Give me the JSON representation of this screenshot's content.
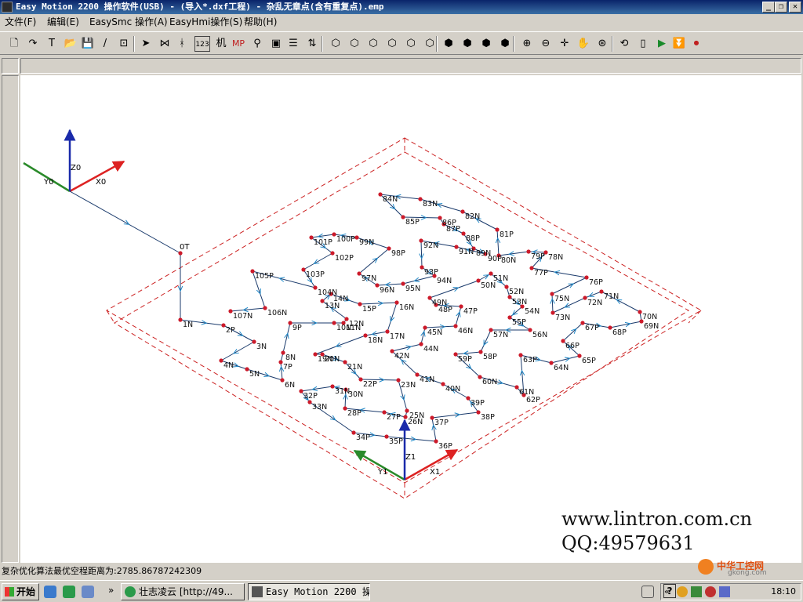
{
  "window": {
    "title": "Easy Motion 2200 操作软件(USB) - (导入*.dxf工程) - 杂乱无章点(含有重复点).emp",
    "min_glyph": "_",
    "max_glyph": "❐",
    "close_glyph": "✕"
  },
  "menu": [
    "文件(F)",
    "编辑(E)",
    "EasySmc 操作(A)",
    "EasyHmi操作(S)",
    "帮助(H)"
  ],
  "toolbar": {
    "icons": [
      "new-icon",
      "redo-icon",
      "text-icon",
      "open-icon",
      "save-icon",
      "pen-icon",
      "calibrate-icon",
      "cursor-icon",
      "mirror-icon",
      "split-icon",
      "number-icon",
      "machine-icon",
      "mp-icon",
      "filter-icon",
      "frame-icon",
      "list-icon",
      "fit-icon",
      "view-cube-1-icon",
      "view-cube-2-icon",
      "view-cube-3-icon",
      "view-cube-4-icon",
      "view-cube-5-icon",
      "view-cube-6-icon",
      "iso-1-icon",
      "iso-2-icon",
      "iso-3-icon",
      "iso-4-icon",
      "zoom-in-icon",
      "zoom-out-icon",
      "crosshair-icon",
      "pan-icon",
      "fit-all-icon",
      "rotate-icon",
      "device-icon",
      "run-icon",
      "download-icon",
      "record-icon"
    ],
    "glyphs": [
      "🗋",
      "↷",
      "T",
      "📂",
      "💾",
      "/",
      "⊡",
      "➤",
      "⋈",
      "ᚼ",
      "123",
      "机",
      "MP",
      "⚲",
      "▣",
      "☰",
      "⇅",
      "⬡",
      "⬡",
      "⬡",
      "⬡",
      "⬡",
      "⬡",
      "⬢",
      "⬢",
      "⬢",
      "⬢",
      "⊕",
      "⊖",
      "✛",
      "✋",
      "⊛",
      "⟲",
      "▯",
      "▶",
      "⏬",
      "⏺"
    ]
  },
  "canvas": {
    "origin_label": "0T",
    "axes_top": {
      "x": "X0",
      "y": "Y0",
      "z": "Z0"
    },
    "axes_bottom": {
      "x": "X1",
      "y": "Y1",
      "z": "Z1"
    },
    "watermark_url": "www.lintron.com.cn",
    "watermark_qq": "QQ:49579631",
    "points": [
      {
        "label": "1N"
      },
      {
        "label": "2P"
      },
      {
        "label": "3N"
      },
      {
        "label": "4N"
      },
      {
        "label": "5N"
      },
      {
        "label": "6N"
      },
      {
        "label": "7P"
      },
      {
        "label": "8N"
      },
      {
        "label": "9P"
      },
      {
        "label": "10N"
      },
      {
        "label": "11N"
      },
      {
        "label": "12N"
      },
      {
        "label": "13N"
      },
      {
        "label": "14N"
      },
      {
        "label": "15P"
      },
      {
        "label": "16N"
      },
      {
        "label": "17N"
      },
      {
        "label": "18N"
      },
      {
        "label": "19N"
      },
      {
        "label": "20N"
      },
      {
        "label": "21N"
      },
      {
        "label": "22P"
      },
      {
        "label": "23N"
      },
      {
        "label": "25N"
      },
      {
        "label": "26N"
      },
      {
        "label": "27P"
      },
      {
        "label": "28P"
      },
      {
        "label": "30N"
      },
      {
        "label": "31N"
      },
      {
        "label": "32P"
      },
      {
        "label": "33N"
      },
      {
        "label": "34P"
      },
      {
        "label": "35P"
      },
      {
        "label": "36P"
      },
      {
        "label": "37P"
      },
      {
        "label": "38P"
      },
      {
        "label": "39P"
      },
      {
        "label": "40N"
      },
      {
        "label": "41N"
      },
      {
        "label": "42N"
      },
      {
        "label": "44N"
      },
      {
        "label": "45N"
      },
      {
        "label": "46N"
      },
      {
        "label": "47P"
      },
      {
        "label": "48P"
      },
      {
        "label": "49N"
      },
      {
        "label": "50N"
      },
      {
        "label": "51N"
      },
      {
        "label": "52N"
      },
      {
        "label": "53N"
      },
      {
        "label": "54N"
      },
      {
        "label": "55P"
      },
      {
        "label": "56N"
      },
      {
        "label": "57N"
      },
      {
        "label": "58P"
      },
      {
        "label": "59P"
      },
      {
        "label": "60N"
      },
      {
        "label": "61N"
      },
      {
        "label": "62P"
      },
      {
        "label": "63P"
      },
      {
        "label": "64N"
      },
      {
        "label": "65P"
      },
      {
        "label": "66P"
      },
      {
        "label": "67P"
      },
      {
        "label": "68P"
      },
      {
        "label": "69N"
      },
      {
        "label": "70N"
      },
      {
        "label": "71N"
      },
      {
        "label": "72N"
      },
      {
        "label": "73N"
      },
      {
        "label": "75N"
      },
      {
        "label": "76P"
      },
      {
        "label": "77P"
      },
      {
        "label": "78N"
      },
      {
        "label": "79P"
      },
      {
        "label": "80N"
      },
      {
        "label": "81P"
      },
      {
        "label": "82N"
      },
      {
        "label": "83N"
      },
      {
        "label": "84N"
      },
      {
        "label": "85P"
      },
      {
        "label": "86P"
      },
      {
        "label": "87P"
      },
      {
        "label": "88P"
      },
      {
        "label": "89N"
      },
      {
        "label": "90P"
      },
      {
        "label": "91N"
      },
      {
        "label": "92N"
      },
      {
        "label": "93P"
      },
      {
        "label": "94N"
      },
      {
        "label": "95N"
      },
      {
        "label": "96N"
      },
      {
        "label": "97N"
      },
      {
        "label": "98P"
      },
      {
        "label": "99N"
      },
      {
        "label": "100P"
      },
      {
        "label": "101P"
      },
      {
        "label": "102P"
      },
      {
        "label": "103P"
      },
      {
        "label": "104N"
      },
      {
        "label": "105P"
      },
      {
        "label": "106N"
      },
      {
        "label": "107N"
      }
    ]
  },
  "status": {
    "text": "复杂优化算法最优空程距离为:2785.86787242309"
  },
  "taskbar": {
    "start": "开始",
    "quicklaunch_more": "»",
    "tasks": [
      {
        "label": "壮志凌云 [http://49...",
        "icon": "browser-icon"
      },
      {
        "label": "Easy Motion 2200 操...",
        "icon": "app-icon"
      }
    ],
    "tray_expand": "«",
    "clock": "18:10",
    "brand": "中华工控网",
    "brand_url": "gkong.com",
    "help_glyph": "?"
  },
  "colors": {
    "titlebar": "#0a246a",
    "path": "#1a3a6b",
    "point": "#cc1a2a",
    "boundary": "#cc2222",
    "axis_x": "#dd2222",
    "axis_y": "#2a8a2a",
    "axis_z": "#1a2aaa"
  }
}
